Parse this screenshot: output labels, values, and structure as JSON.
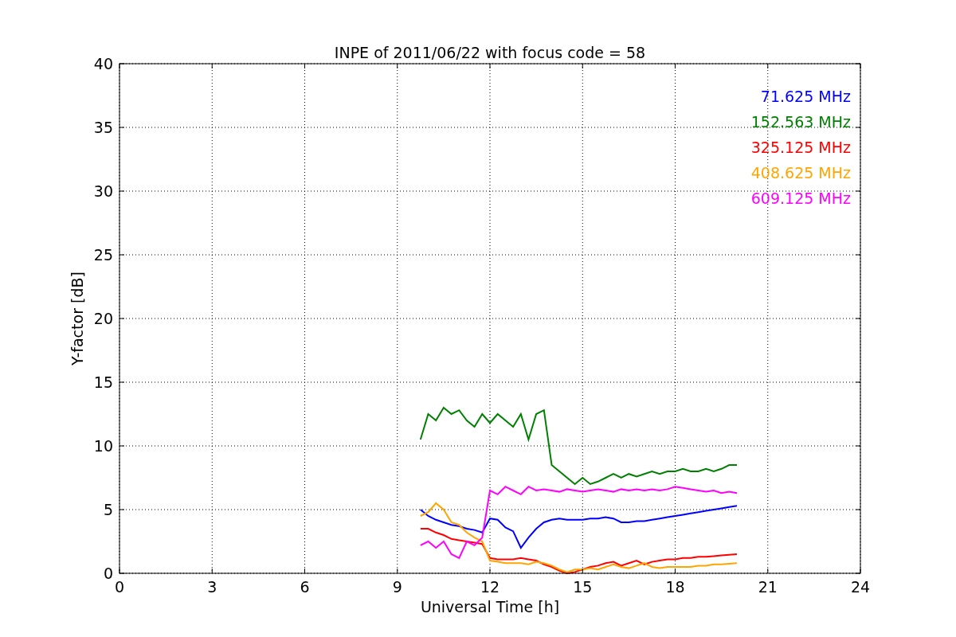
{
  "chart_data": {
    "type": "line",
    "title": "INPE of 2011/06/22 with focus code = 58",
    "xlabel": "Universal Time [h]",
    "ylabel": "Y-factor [dB]",
    "x": [
      9.75,
      10,
      10.25,
      10.5,
      10.75,
      11,
      11.25,
      11.5,
      11.75,
      12,
      12.25,
      12.5,
      12.75,
      13,
      13.25,
      13.5,
      13.75,
      14,
      14.25,
      14.5,
      14.75,
      15,
      15.25,
      15.5,
      15.75,
      16,
      16.25,
      16.5,
      16.75,
      17,
      17.25,
      17.5,
      17.75,
      18,
      18.25,
      18.5,
      18.75,
      19,
      19.25,
      19.5,
      19.75,
      20
    ],
    "series": [
      {
        "name": "71.625 MHz",
        "color": "#0000ff",
        "values": [
          5,
          4.5,
          4.2,
          4,
          3.8,
          3.7,
          3.5,
          3.4,
          3.2,
          4.3,
          4.2,
          3.6,
          3.3,
          2.0,
          2.8,
          3.5,
          4.0,
          4.2,
          4.3,
          4.2,
          4.2,
          4.2,
          4.3,
          4.3,
          4.4,
          4.3,
          4.0,
          4.0,
          4.1,
          4.1,
          4.2,
          4.3,
          4.4,
          4.5,
          4.6,
          4.7,
          4.8,
          4.9,
          5.0,
          5.1,
          5.2,
          5.3
        ]
      },
      {
        "name": "152.563 MHz",
        "color": "#008000",
        "values": [
          10.5,
          12.5,
          12,
          13,
          12.5,
          12.8,
          12,
          11.5,
          12.5,
          11.8,
          12.5,
          12,
          11.5,
          12.5,
          10.5,
          12.5,
          12.8,
          8.5,
          8,
          7.5,
          7,
          7.5,
          7,
          7.2,
          7.5,
          7.8,
          7.5,
          7.8,
          7.6,
          7.8,
          8,
          7.8,
          8,
          8,
          8.2,
          8,
          8,
          8.2,
          8,
          8.2,
          8.5,
          8.5
        ]
      },
      {
        "name": "325.125 MHz",
        "color": "#ff0000",
        "values": [
          3.5,
          3.5,
          3.2,
          3,
          2.7,
          2.6,
          2.5,
          2.4,
          2.3,
          1.2,
          1.1,
          1.1,
          1.1,
          1.2,
          1.1,
          1.0,
          0.7,
          0.5,
          0.2,
          0,
          0.1,
          0.3,
          0.5,
          0.6,
          0.8,
          0.9,
          0.6,
          0.8,
          1.0,
          0.7,
          0.9,
          1.0,
          1.1,
          1.1,
          1.2,
          1.2,
          1.3,
          1.3,
          1.35,
          1.4,
          1.45,
          1.5
        ]
      },
      {
        "name": "408.625 MHz",
        "color": "#ffa500",
        "values": [
          4.5,
          4.8,
          5.5,
          5,
          4,
          3.8,
          3.2,
          2.8,
          2.5,
          1.0,
          0.9,
          0.8,
          0.8,
          0.8,
          0.7,
          0.9,
          0.8,
          0.6,
          0.3,
          0.1,
          0.3,
          0.3,
          0.4,
          0.3,
          0.5,
          0.7,
          0.5,
          0.4,
          0.6,
          0.8,
          0.5,
          0.4,
          0.5,
          0.5,
          0.5,
          0.5,
          0.6,
          0.6,
          0.7,
          0.7,
          0.75,
          0.8
        ]
      },
      {
        "name": "609.125 MHz",
        "color": "#ff00ff",
        "values": [
          2.2,
          2.5,
          2,
          2.5,
          1.5,
          1.2,
          2.5,
          2.2,
          2.8,
          6.5,
          6.2,
          6.8,
          6.5,
          6.2,
          6.8,
          6.5,
          6.6,
          6.5,
          6.4,
          6.6,
          6.5,
          6.4,
          6.5,
          6.6,
          6.5,
          6.4,
          6.6,
          6.5,
          6.6,
          6.5,
          6.6,
          6.5,
          6.6,
          6.8,
          6.7,
          6.6,
          6.5,
          6.4,
          6.5,
          6.3,
          6.4,
          6.3
        ]
      }
    ],
    "xlim": [
      0,
      24
    ],
    "ylim": [
      0,
      40
    ],
    "xticks": [
      0,
      3,
      6,
      9,
      12,
      15,
      18,
      21,
      24
    ],
    "yticks": [
      0,
      5,
      10,
      15,
      20,
      25,
      30,
      35,
      40
    ],
    "grid": true
  }
}
